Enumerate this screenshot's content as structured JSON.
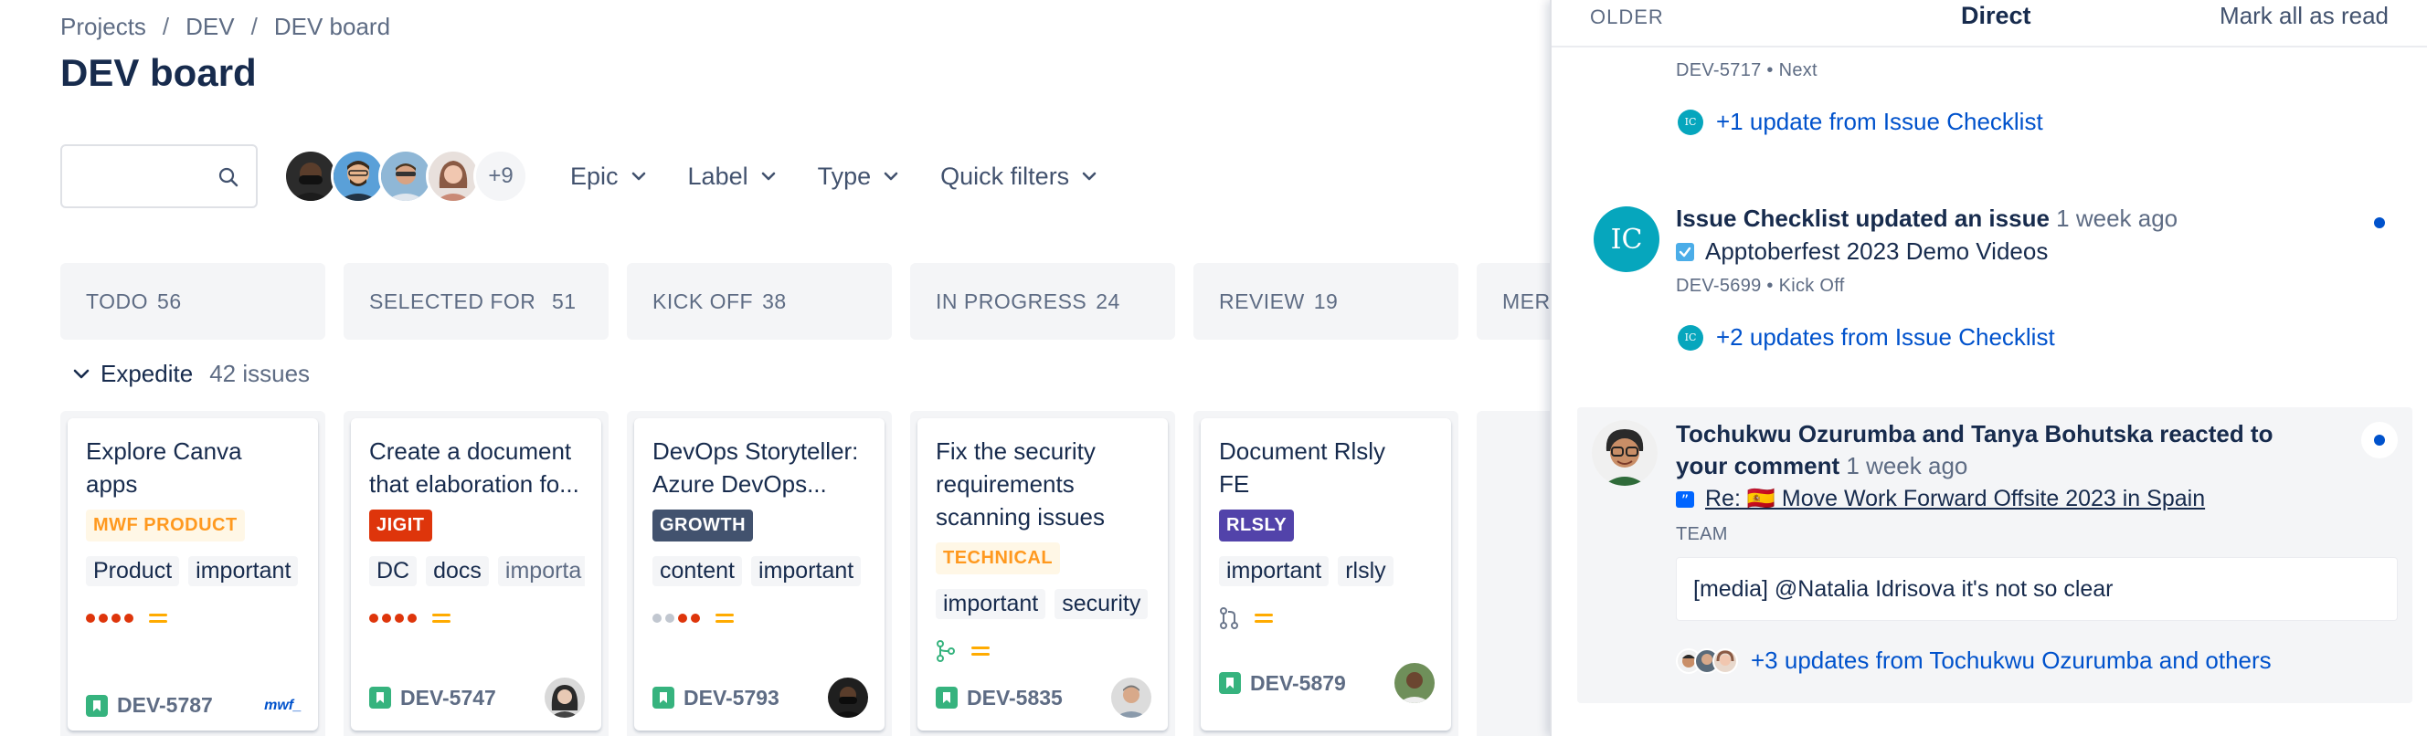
{
  "breadcrumbs": [
    "Projects",
    "DEV",
    "DEV board"
  ],
  "page_title": "DEV board",
  "search": {
    "value": "",
    "placeholder": ""
  },
  "avatars_more": "+9",
  "filters": [
    "Epic",
    "Label",
    "Type",
    "Quick filters"
  ],
  "columns": [
    {
      "name": "TODO",
      "count": "56"
    },
    {
      "name": "SELECTED FOR ...",
      "count": "51"
    },
    {
      "name": "KICK OFF",
      "count": "38"
    },
    {
      "name": "IN PROGRESS",
      "count": "24"
    },
    {
      "name": "REVIEW",
      "count": "19"
    },
    {
      "name": "MER",
      "count": ""
    }
  ],
  "swimlane": {
    "name": "Expedite",
    "count": "42 issues"
  },
  "cards": [
    {
      "title": "Explore Canva apps",
      "epic": "MWF PRODUCT",
      "epic_bg": "#fff7e6",
      "epic_fg": "#ff991f",
      "labels": [
        "Product",
        "important"
      ],
      "key": "DEV-5787",
      "logo": "mwf_"
    },
    {
      "title": "Create a document that elaboration fo...",
      "epic": "JIGIT",
      "epic_bg": "#de350b",
      "epic_fg": "#ffffff",
      "labels": [
        "DC",
        "docs",
        "importa"
      ],
      "key": "DEV-5747"
    },
    {
      "title": "DevOps Storyteller: Azure DevOps...",
      "epic": "GROWTH",
      "epic_bg": "#42526e",
      "epic_fg": "#ffffff",
      "labels": [
        "content",
        "important"
      ],
      "key": "DEV-5793"
    },
    {
      "title": "Fix the security requirements scanning issues",
      "epic": "TECHNICAL",
      "epic_bg": "#fff7e6",
      "epic_fg": "#ff991f",
      "labels": [
        "important",
        "security"
      ],
      "key": "DEV-5835"
    },
    {
      "title": "Document Rlsly FE",
      "epic": "RLSLY",
      "epic_bg": "#5243aa",
      "epic_fg": "#ffffff",
      "labels": [
        "important",
        "rlsly"
      ],
      "key": "DEV-5879"
    }
  ],
  "panel": {
    "tab_older": "OLDER",
    "tab_direct": "Direct",
    "mark_all": "Mark all as read",
    "n1": {
      "meta": "DEV-5717 • Next",
      "link": "+1 update from Issue Checklist"
    },
    "n2": {
      "avatar": "IC",
      "actor": "Issue Checklist updated an issue",
      "time": "1 week ago",
      "issue": "Apptoberfest 2023 Demo Videos",
      "meta": "DEV-5699 • Kick Off",
      "link": "+2 updates from Issue Checklist"
    },
    "n3": {
      "actor": "Tochukwu Ozurumba and Tanya Bohutska reacted to your comment",
      "time": "1 week ago",
      "page": "Re: 🇪🇸 Move Work Forward Offsite 2023 in Spain",
      "space": "TEAM",
      "comment": "[media] @Natalia Idrisova it's not so clear",
      "link": "+3 updates from Tochukwu Ozurumba and others"
    }
  },
  "colors": {
    "link": "#0052cc",
    "unread_dot": "#0052cc",
    "story_green": "#36b37e",
    "priority_orange": "#ffab00",
    "panel_badge": "#06a6bd"
  }
}
